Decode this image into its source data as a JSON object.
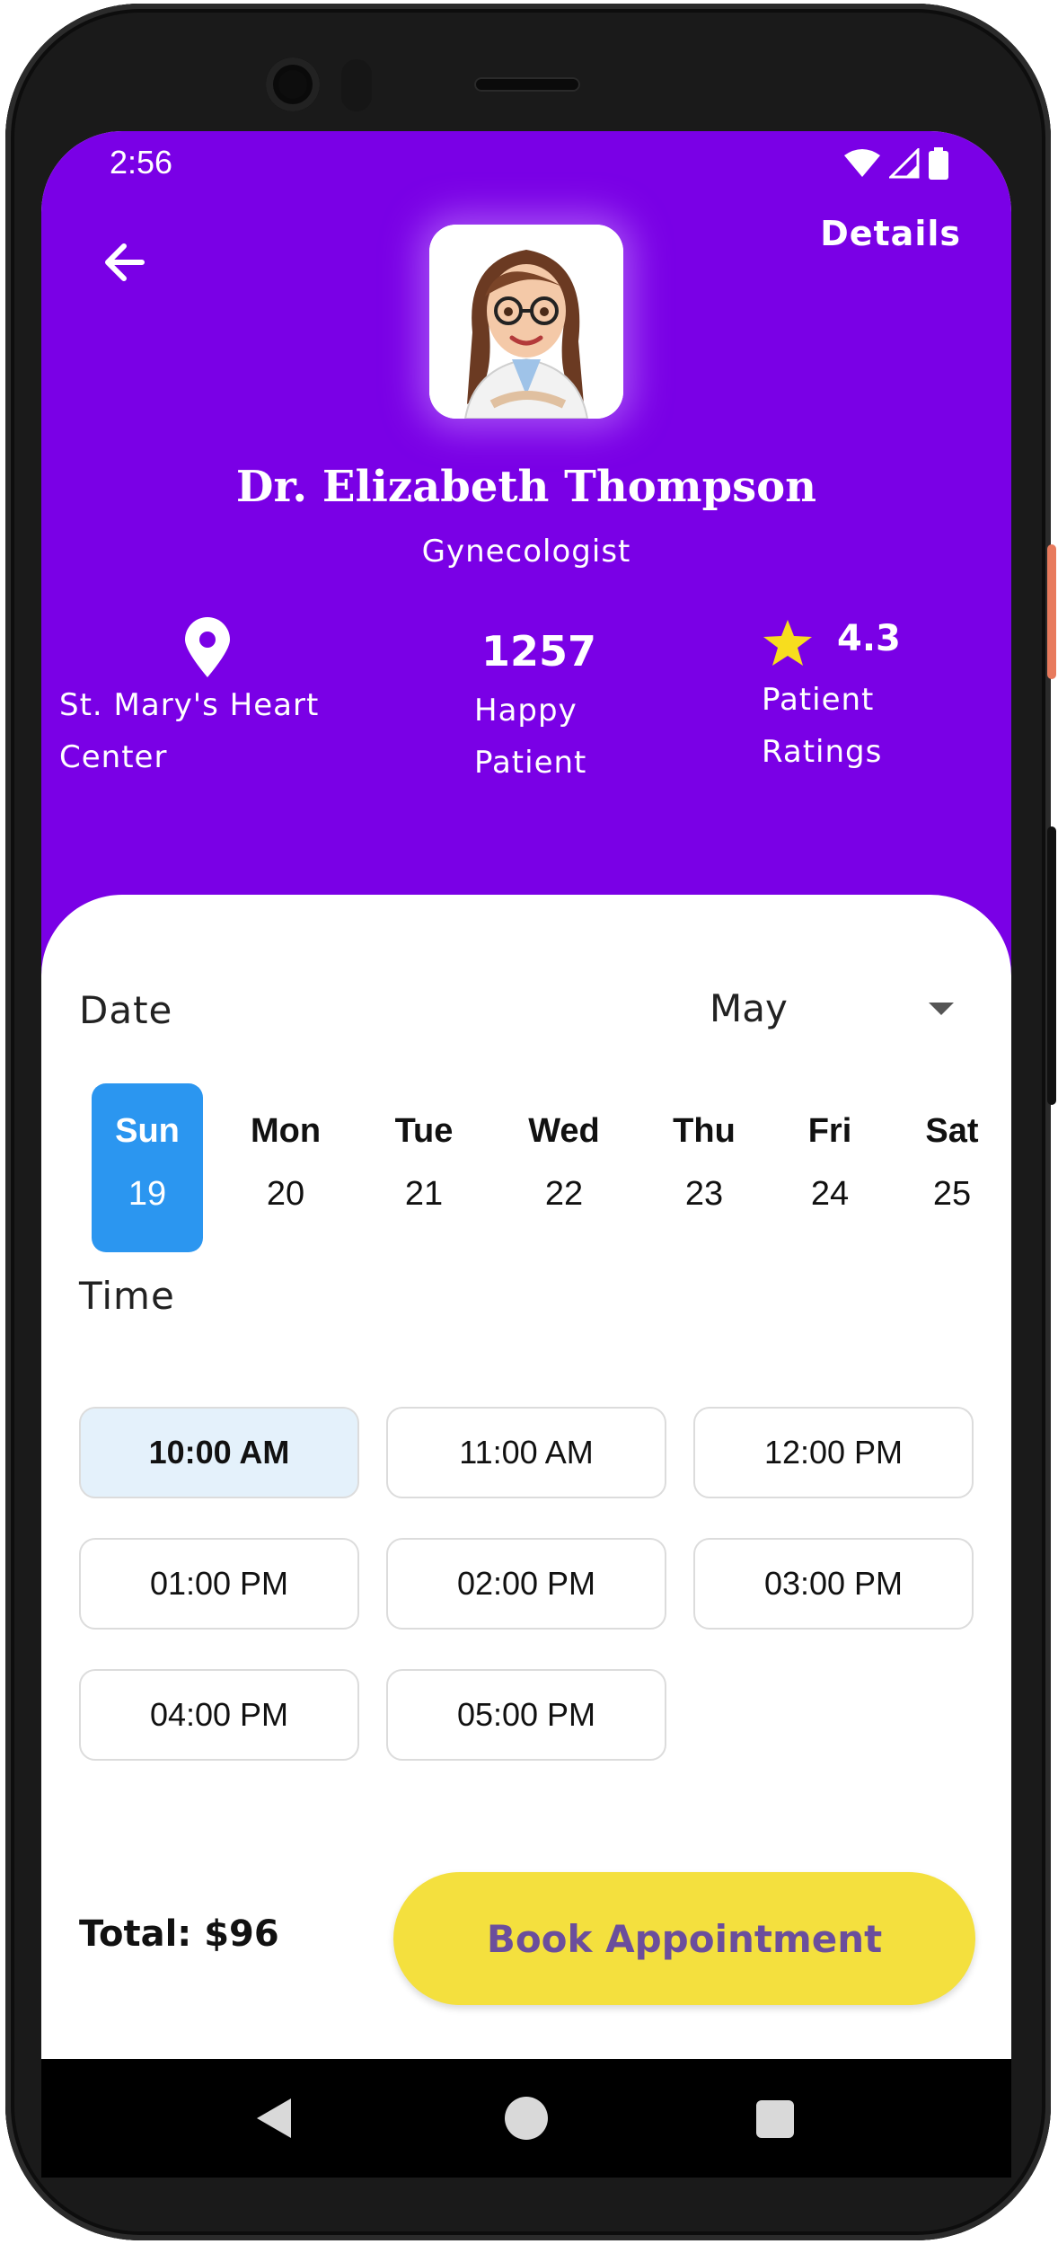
{
  "status_bar": {
    "time": "2:56"
  },
  "header": {
    "details_label": "Details"
  },
  "doctor": {
    "name": "Dr. Elizabeth Thompson",
    "specialty": "Gynecologist"
  },
  "stats": {
    "location_line1": "St. Mary's Heart",
    "location_line2": "Center",
    "patients_value": "1257",
    "patients_line1": "Happy",
    "patients_line2": "Patient",
    "rating_value": "4.3",
    "rating_line1": "Patient",
    "rating_line2": "Ratings"
  },
  "date_section": {
    "title": "Date",
    "month": "May",
    "days": [
      {
        "name": "Sun",
        "num": "19",
        "selected": true
      },
      {
        "name": "Mon",
        "num": "20"
      },
      {
        "name": "Tue",
        "num": "21"
      },
      {
        "name": "Wed",
        "num": "22"
      },
      {
        "name": "Thu",
        "num": "23"
      },
      {
        "name": "Fri",
        "num": "24"
      },
      {
        "name": "Sat",
        "num": "25"
      }
    ]
  },
  "time_section": {
    "title": "Time",
    "slots": [
      "10:00 AM",
      "11:00 AM",
      "12:00 PM",
      "01:00 PM",
      "02:00 PM",
      "03:00 PM",
      "04:00 PM",
      "05:00 PM"
    ],
    "selected": "10:00 AM"
  },
  "footer": {
    "total": "Total: $96",
    "book_label": "Book Appointment"
  },
  "colors": {
    "header_bg": "#7a00e6",
    "selected_day": "#2b96f0",
    "selected_slot": "#e4f1fb",
    "book_button": "#f4e03e",
    "book_text": "#6b4e9c",
    "star": "#f7dd1e"
  }
}
